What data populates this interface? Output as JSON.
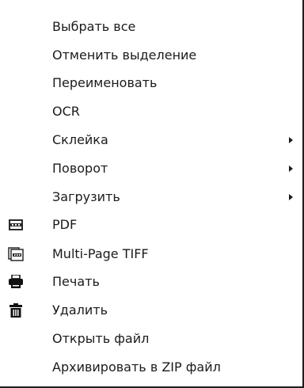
{
  "context_menu": {
    "items": [
      {
        "label": "Выбрать все",
        "icon": null,
        "has_submenu": false
      },
      {
        "label": "Отменить выделение",
        "icon": null,
        "has_submenu": false
      },
      {
        "label": "Переименовать",
        "icon": null,
        "has_submenu": false
      },
      {
        "label": "OCR",
        "icon": null,
        "has_submenu": false
      },
      {
        "label": "Склейка",
        "icon": null,
        "has_submenu": true
      },
      {
        "label": "Поворот",
        "icon": null,
        "has_submenu": true
      },
      {
        "label": "Загрузить",
        "icon": null,
        "has_submenu": true
      },
      {
        "label": "PDF",
        "icon": "pdf-file-icon",
        "has_submenu": false
      },
      {
        "label": "Multi-Page TIFF",
        "icon": "tiff-file-icon",
        "has_submenu": false
      },
      {
        "label": "Печать",
        "icon": "printer-icon",
        "has_submenu": false
      },
      {
        "label": "Удалить",
        "icon": "trash-icon",
        "has_submenu": false
      },
      {
        "label": "Открыть файл",
        "icon": null,
        "has_submenu": false
      },
      {
        "label": "Архивировать в ZIP файл",
        "icon": null,
        "has_submenu": false
      }
    ]
  }
}
